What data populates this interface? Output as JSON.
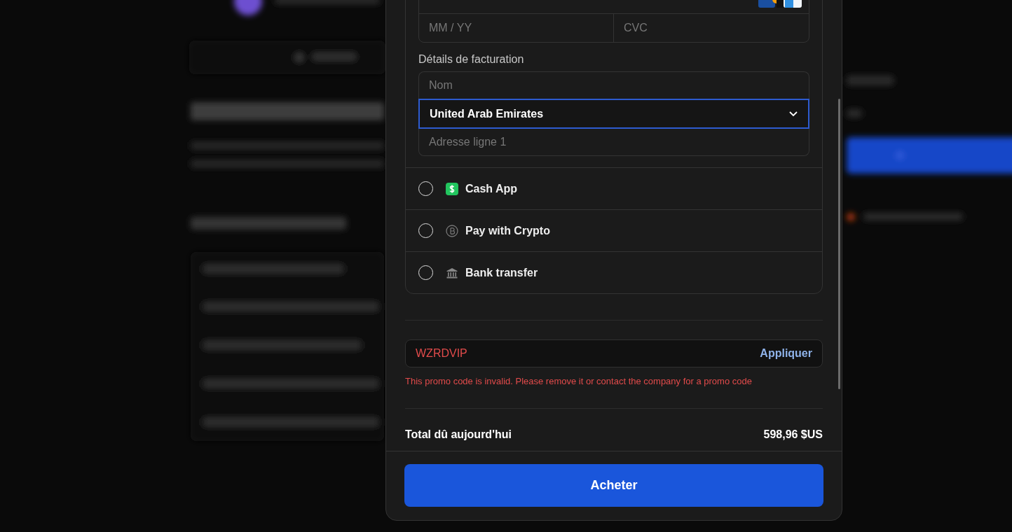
{
  "card": {
    "expiry_placeholder": "MM / YY",
    "cvc_placeholder": "CVC"
  },
  "billing": {
    "label": "Détails de facturation",
    "name_placeholder": "Nom",
    "country": "United Arab Emirates",
    "country_focused": true,
    "address_placeholder": "Adresse ligne 1"
  },
  "payment_methods": [
    {
      "kind": "cashapp",
      "label": "Cash App",
      "selected": false
    },
    {
      "kind": "crypto",
      "label": "Pay with Crypto",
      "selected": false
    },
    {
      "kind": "bank",
      "label": "Bank transfer",
      "selected": false
    }
  ],
  "promo": {
    "value": "WZRDVIP",
    "invalid": true,
    "apply_label": "Appliquer",
    "error": "This promo code is invalid. Please remove it or contact the company for a promo code"
  },
  "total": {
    "label": "Total dû aujourd'hui",
    "amount": "598,96 $US"
  },
  "buy_button": "Acheter"
}
